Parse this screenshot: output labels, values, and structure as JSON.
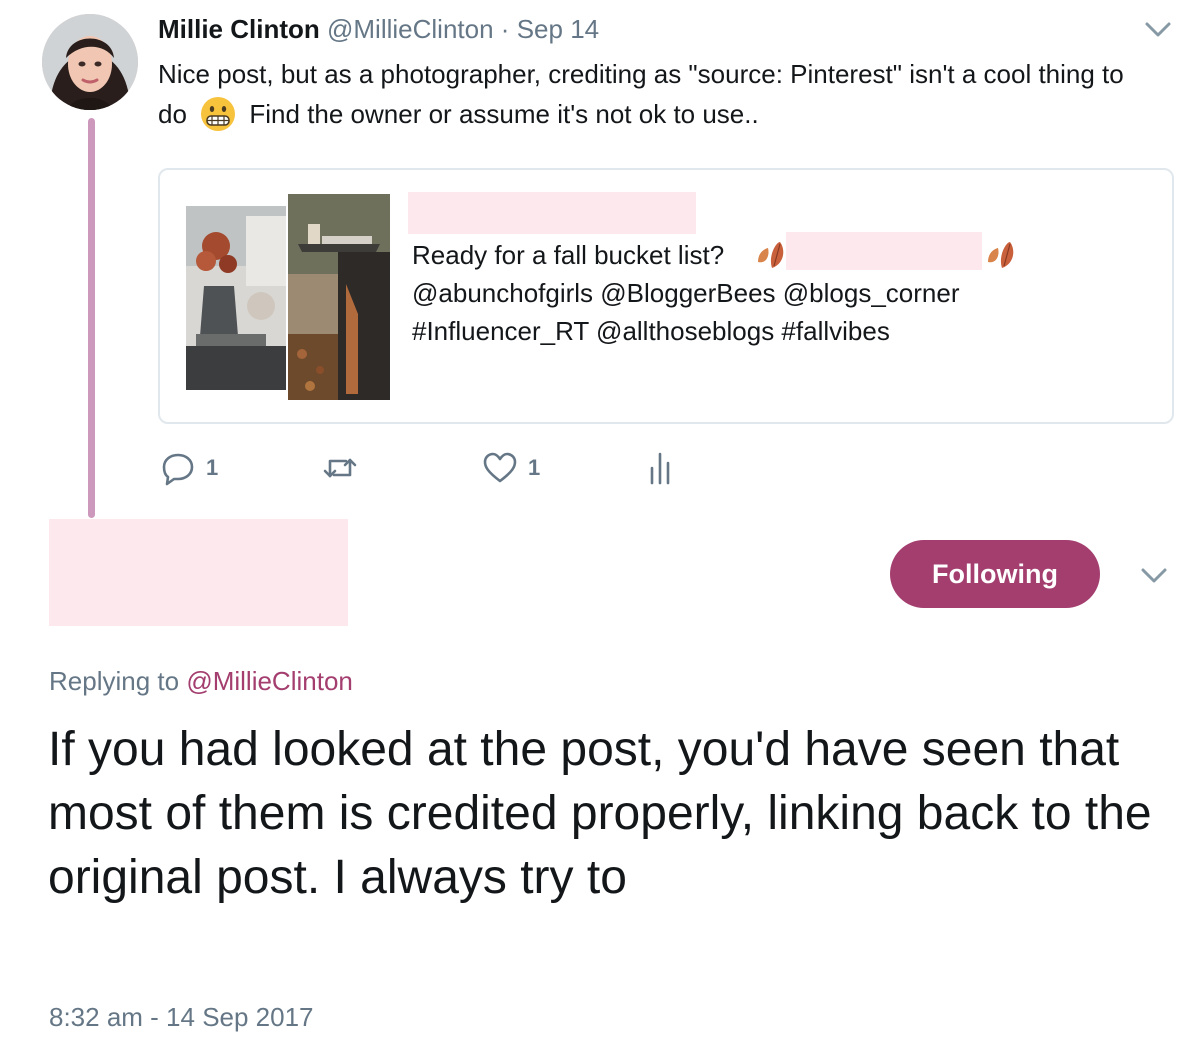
{
  "parent_tweet": {
    "author_name": "Millie Clinton",
    "author_handle": "@MillieClinton",
    "separator": "·",
    "date": "Sep 14",
    "text_part1": "Nice post, but as a photographer, crediting as \"source: Pinterest\" isn't a cool thing to do",
    "emoji": "grimacing-face",
    "text_part2": "Find the owner or assume it's not ok to use..",
    "quoted": {
      "line1": "Ready for a fall bucket list?",
      "line2": "@abunchofgirls @BloggerBees @blogs_corner",
      "line3": "#Influencer_RT @allthoseblogs #fallvibes"
    },
    "actions": {
      "reply_count": "1",
      "like_count": "1"
    }
  },
  "reply": {
    "follow_label": "Following",
    "replying_prefix": "Replying to",
    "replying_handle": "@MillieClinton",
    "text": "If you had looked at the post, you'd have seen that most of them is credited properly, linking back to the original post. I always try to",
    "timestamp": "8:32 am - 14 Sep 2017"
  },
  "colors": {
    "accent": "#a33e6f",
    "thread_line": "#cc98bb",
    "muted_text": "#657786",
    "redaction": "#fde8ee"
  }
}
